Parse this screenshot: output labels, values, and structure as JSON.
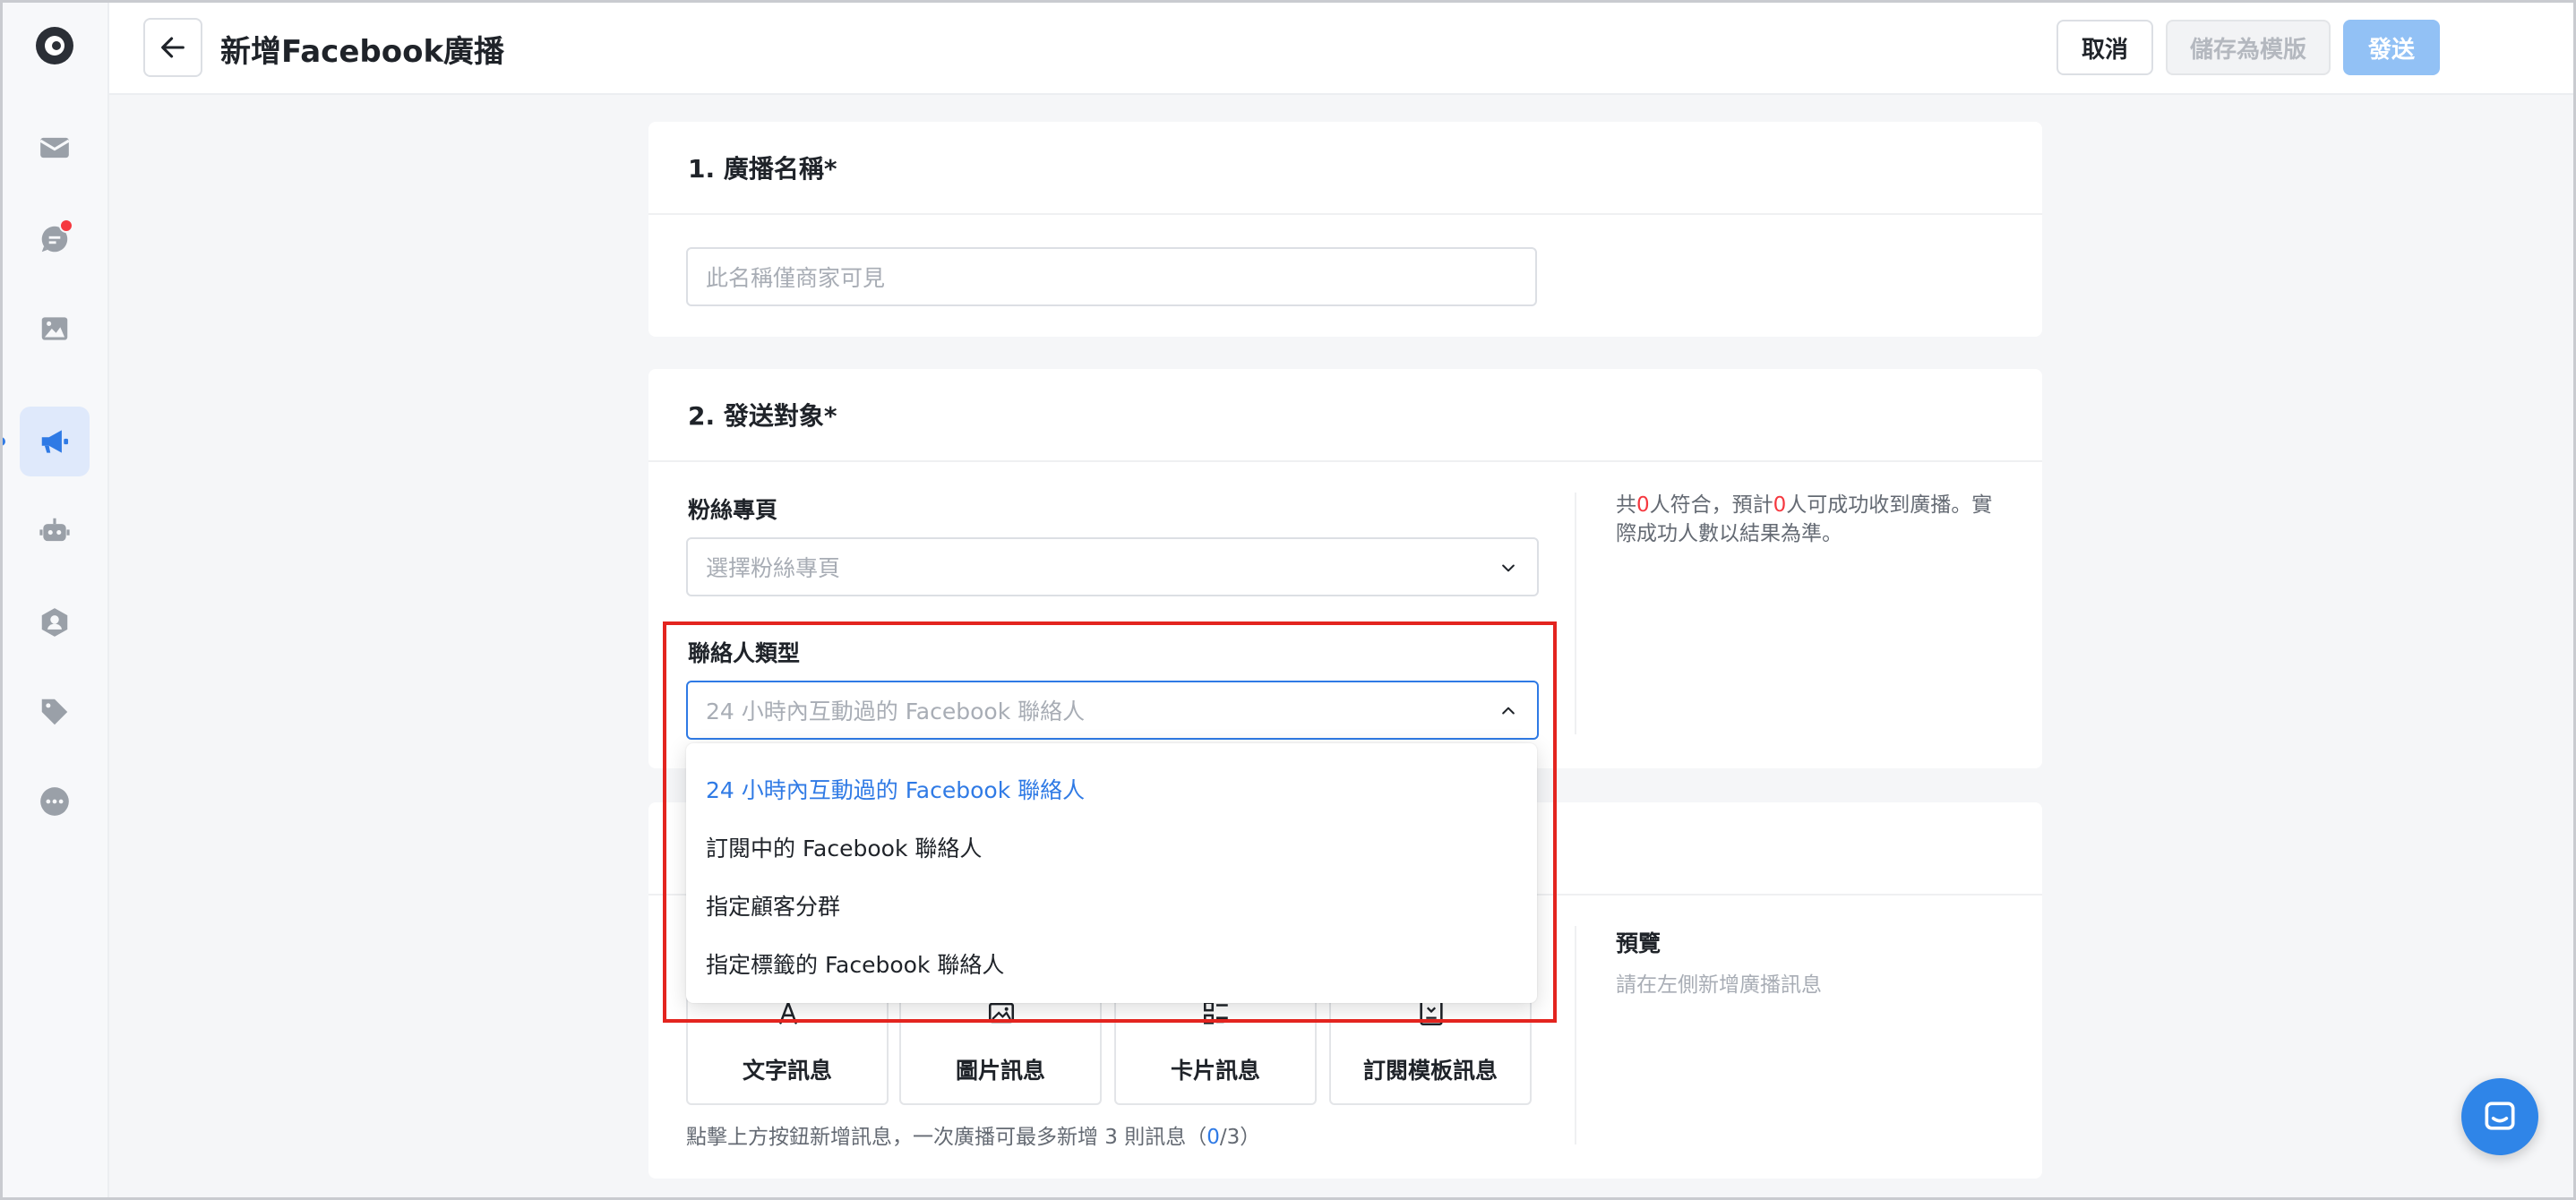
{
  "header": {
    "title": "新增Facebook廣播",
    "buttons": {
      "cancel": "取消",
      "save_template": "儲存為模版",
      "send": "發送"
    }
  },
  "sidebar": {
    "items": [
      {
        "icon": "inbox-icon"
      },
      {
        "icon": "chat-icon",
        "badge": true
      },
      {
        "icon": "image-icon"
      },
      {
        "icon": "megaphone-icon",
        "active": true
      },
      {
        "icon": "bot-icon"
      },
      {
        "icon": "contacts-icon"
      },
      {
        "icon": "tag-icon"
      },
      {
        "icon": "more-icon"
      }
    ]
  },
  "section1": {
    "title": "1. 廣播名稱*",
    "name_placeholder": "此名稱僅商家可見"
  },
  "section2": {
    "title": "2. 發送對象*",
    "fanpage_label": "粉絲專頁",
    "fanpage_placeholder": "選擇粉絲專頁",
    "contact_type_label": "聯絡人類型",
    "contact_type_value": "24 小時內互動過的 Facebook 聯絡人",
    "summary": {
      "prefix": "共",
      "matched_count": "0",
      "mid": "人符合，預計",
      "deliverable_count": "0",
      "suffix": "人可成功收到廣播。實際成功人數以結果為準。"
    },
    "contact_type_options": [
      "24 小時內互動過的 Facebook 聯絡人",
      "訂閱中的 Facebook 聯絡人",
      "指定顧客分群",
      "指定標籤的 Facebook 聯絡人"
    ],
    "selected_option_index": 0
  },
  "section3": {
    "message_types": [
      {
        "label": "文字訊息",
        "icon": "text-icon"
      },
      {
        "label": "圖片訊息",
        "icon": "picture-icon"
      },
      {
        "label": "卡片訊息",
        "icon": "card-list-icon"
      },
      {
        "label": "訂閱模板訊息",
        "icon": "subscription-template-icon"
      }
    ],
    "hint_prefix": "點擊上方按鈕新增訊息，一次廣播可最多新增 3 則訊息（",
    "hint_count": "0",
    "hint_suffix": "/3）",
    "preview_label": "預覽",
    "preview_placeholder": "請在左側新增廣播訊息"
  },
  "colors": {
    "accent": "#2f7ae5",
    "alert": "#f5383f",
    "highlight": "#e3241f"
  }
}
